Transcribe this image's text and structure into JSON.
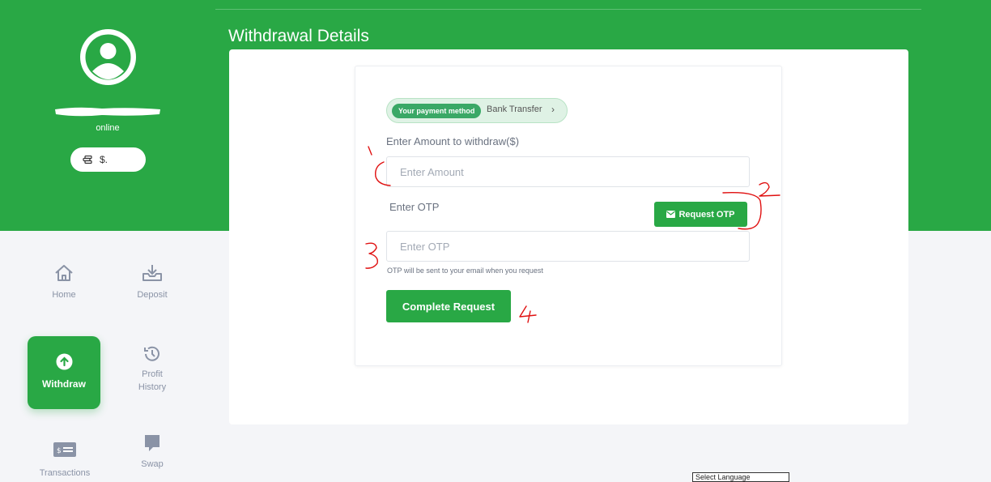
{
  "profile": {
    "status": "online",
    "balance_currency": "$."
  },
  "nav": {
    "home": "Home",
    "deposit": "Deposit",
    "withdraw": "Withdraw",
    "profit_history_1": "Profit",
    "profit_history_2": "History",
    "transactions": "Transactions",
    "swap": "Swap"
  },
  "page": {
    "title": "Withdrawal Details"
  },
  "payment_method": {
    "badge": "Your payment method",
    "value": "Bank Transfer",
    "chevron": "›"
  },
  "form": {
    "amount_label": "Enter Amount to withdraw($)",
    "amount_placeholder": "Enter Amount",
    "otp_label": "Enter OTP",
    "otp_button": "Request OTP",
    "otp_placeholder": "Enter OTP",
    "otp_hint": "OTP will be sent to your email when you request",
    "submit": "Complete Request"
  },
  "annotations": [
    "1",
    "2",
    "3",
    "4"
  ],
  "language_select": "Select Language",
  "colors": {
    "brand_green": "#29a845",
    "annotation_red": "#e01010"
  }
}
